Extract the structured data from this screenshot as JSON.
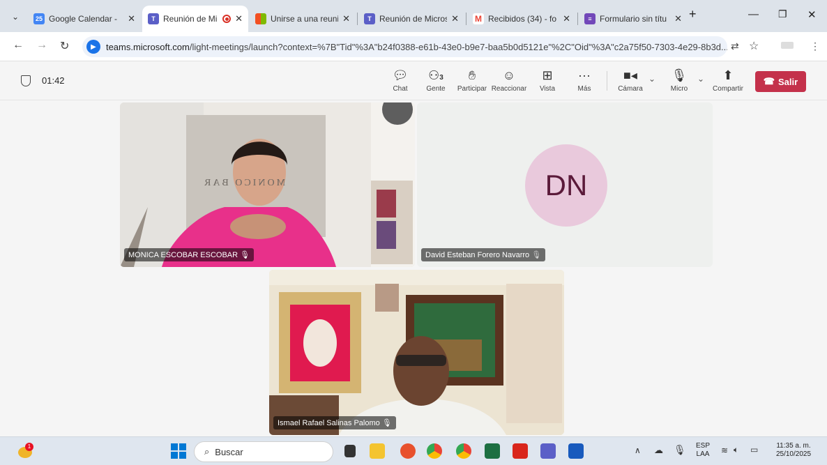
{
  "tabs": [
    {
      "title": "Google Calendar -",
      "active": false,
      "favicon": "calendar-icon",
      "color": "#4285f4",
      "glyph": "25"
    },
    {
      "title": "Reunión de Mi",
      "active": true,
      "favicon": "teams-icon",
      "color": "#5b5fc7",
      "glyph": "T",
      "recording": true
    },
    {
      "title": "Unirse a una reuni",
      "active": false,
      "favicon": "microsoft-icon",
      "color": "#f25022",
      "glyph": "■"
    },
    {
      "title": "Reunión de Micros",
      "active": false,
      "favicon": "teams-icon",
      "color": "#5b5fc7",
      "glyph": "T"
    },
    {
      "title": "Recibidos (34) - fo",
      "active": false,
      "favicon": "gmail-icon",
      "color": "#ea4335",
      "glyph": "M"
    },
    {
      "title": "Formulario sin títu",
      "active": false,
      "favicon": "forms-icon",
      "color": "#7248b9",
      "glyph": "≡"
    }
  ],
  "address": {
    "domain": "teams.microsoft.com",
    "path": "/light-meetings/launch?context=%7B\"Tid\"%3A\"b24f0388-e61b-43e0-b9e7-baa5b0d5121e\"%2C\"Oid\"%3A\"c2a75f50-7303-4e29-8b3d..."
  },
  "meeting": {
    "timer": "01:42",
    "controls": {
      "chat": "Chat",
      "people": "Gente",
      "people_count": "3",
      "raise": "Participar",
      "react": "Reaccionar",
      "view": "Vista",
      "more": "Más",
      "camera": "Cámara",
      "mic": "Micro",
      "share": "Compartir",
      "leave": "Salir"
    },
    "participants": [
      {
        "name": "MONICA ESCOBAR ESCOBAR",
        "video": true,
        "mic_icon": "mic-icon"
      },
      {
        "name": "David Esteban Forero Navarro",
        "video": false,
        "initials": "DN",
        "mic_icon": "mic-off-icon"
      },
      {
        "name": "Ismael Rafael Salinas Palomo",
        "video": true,
        "mic_icon": "mic-icon"
      }
    ],
    "wall_text": "MONICO BAR"
  },
  "taskbar": {
    "search_placeholder": "Buscar",
    "notification_count": "1",
    "lang_top": "ESP",
    "lang_bottom": "LAA",
    "time": "11:35 a. m.",
    "date": "25/10/2025"
  }
}
